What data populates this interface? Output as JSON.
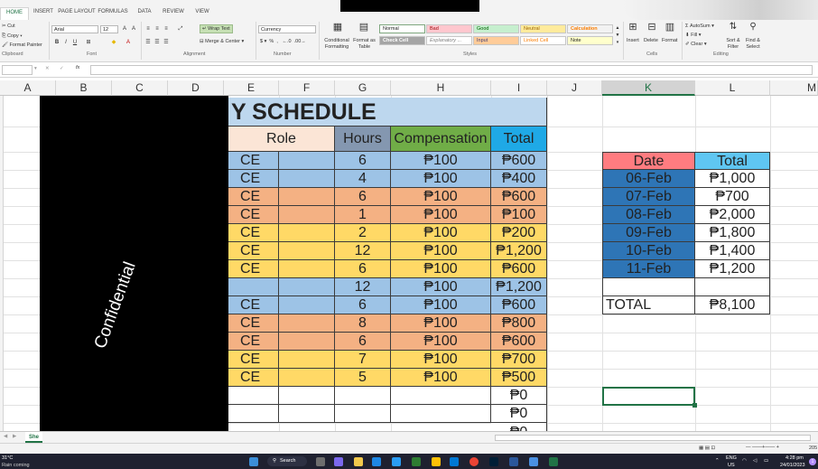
{
  "ribbon": {
    "tabs": [
      "HOME",
      "INSERT",
      "PAGE LAYOUT",
      "FORMULAS",
      "DATA",
      "REVIEW",
      "VIEW"
    ],
    "clipboard": {
      "cut": "Cut",
      "copy": "Copy",
      "format_painter": "Format Painter",
      "label": "Clipboard"
    },
    "font": {
      "name": "Arial",
      "size": "12",
      "label": "Font"
    },
    "alignment": {
      "wrap_text": "Wrap Text",
      "merge_center": "Merge & Center",
      "label": "Alignment"
    },
    "number": {
      "format": "Currency",
      "label": "Number"
    },
    "styles": {
      "conditional": "Conditional Formatting",
      "format_as_table": "Format as Table",
      "items": [
        "Normal",
        "Bad",
        "Good",
        "Neutral",
        "Calculation",
        "Check Cell",
        "Explanatory ...",
        "Input",
        "Linked Cell",
        "Note"
      ],
      "label": "Styles"
    },
    "cells": {
      "insert": "Insert",
      "delete": "Delete",
      "format": "Format",
      "label": "Cells"
    },
    "editing": {
      "autosum": "AutoSum",
      "fill": "Fill",
      "clear": "Clear",
      "sort": "Sort & Filter",
      "find": "Find & Select",
      "label": "Editing"
    }
  },
  "columns": [
    "A",
    "B",
    "C",
    "D",
    "E",
    "F",
    "G",
    "H",
    "I",
    "J",
    "K",
    "L",
    "M"
  ],
  "selected_column": "K",
  "sheet": {
    "title": "Y SCHEDULE",
    "headers": {
      "role": "Role",
      "hours": "Hours",
      "compensation": "Compensation",
      "total": "Total"
    },
    "rows": [
      {
        "role": "CE",
        "hours": "6",
        "comp": "₱100",
        "total": "₱600",
        "color": "blue"
      },
      {
        "role": "CE",
        "hours": "4",
        "comp": "₱100",
        "total": "₱400",
        "color": "blue"
      },
      {
        "role": "CE",
        "hours": "6",
        "comp": "₱100",
        "total": "₱600",
        "color": "orange"
      },
      {
        "role": "CE",
        "hours": "1",
        "comp": "₱100",
        "total": "₱100",
        "color": "orange"
      },
      {
        "role": "CE",
        "hours": "2",
        "comp": "₱100",
        "total": "₱200",
        "color": "yellow"
      },
      {
        "role": "CE",
        "hours": "12",
        "comp": "₱100",
        "total": "₱1,200",
        "color": "yellow"
      },
      {
        "role": "CE",
        "hours": "6",
        "comp": "₱100",
        "total": "₱600",
        "color": "yellow"
      },
      {
        "role": "",
        "hours": "12",
        "comp": "₱100",
        "total": "₱1,200",
        "color": "blue"
      },
      {
        "role": "CE",
        "hours": "6",
        "comp": "₱100",
        "total": "₱600",
        "color": "blue"
      },
      {
        "role": "CE",
        "hours": "8",
        "comp": "₱100",
        "total": "₱800",
        "color": "orange"
      },
      {
        "role": "CE",
        "hours": "6",
        "comp": "₱100",
        "total": "₱600",
        "color": "orange"
      },
      {
        "role": "CE",
        "hours": "7",
        "comp": "₱100",
        "total": "₱700",
        "color": "yellow"
      },
      {
        "role": "CE",
        "hours": "5",
        "comp": "₱100",
        "total": "₱500",
        "color": "yellow"
      },
      {
        "role": "",
        "hours": "",
        "comp": "",
        "total": "₱0",
        "color": "white"
      },
      {
        "role": "",
        "hours": "",
        "comp": "",
        "total": "₱0",
        "color": "white"
      }
    ],
    "partial_total": "₱0"
  },
  "summary": {
    "header_date": "Date",
    "header_total": "Total",
    "rows": [
      {
        "date": "06-Feb",
        "total": "₱1,000"
      },
      {
        "date": "07-Feb",
        "total": "₱700"
      },
      {
        "date": "08-Feb",
        "total": "₱2,000"
      },
      {
        "date": "09-Feb",
        "total": "₱1,800"
      },
      {
        "date": "10-Feb",
        "total": "₱1,400"
      },
      {
        "date": "11-Feb",
        "total": "₱1,200"
      }
    ],
    "total_label": "TOTAL",
    "total_value": "₱8,100"
  },
  "redaction": {
    "text": "Confidential"
  },
  "sheet_tab": "She",
  "taskbar": {
    "weather_temp": "31°C",
    "weather_desc": "Rain coming",
    "search": "Search",
    "lang": "ENG",
    "region": "US",
    "time": "4:28 pm",
    "date": "24/01/2023",
    "notifications": "1"
  },
  "zoom": "205",
  "colors": {
    "excel_green": "#217346",
    "blue_fill": "#9dc3e6",
    "orange_fill": "#f4b183",
    "yellow_fill": "#ffd966",
    "date_header": "#ff7c80",
    "total_header": "#5fc6f2",
    "date_cells": "#2e75b6"
  }
}
